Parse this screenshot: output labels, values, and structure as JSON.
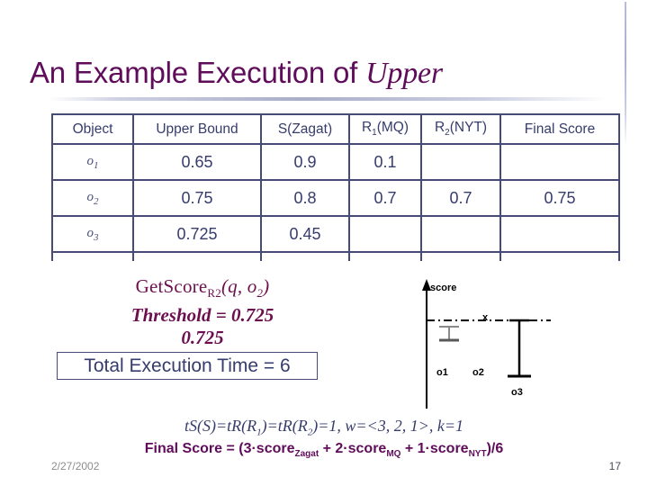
{
  "slide": {
    "title_plain": "An Example Execution of ",
    "title_emphasis": "Upper",
    "accent_color": "#5f0d5a",
    "table_color": "#363c6b",
    "highlight_color": "#7c0b3c"
  },
  "table": {
    "headers": [
      {
        "text": "Object",
        "sub": ""
      },
      {
        "text": "Upper Bound",
        "sub": ""
      },
      {
        "text": "S(Zagat)",
        "sub": ""
      },
      {
        "text": "R",
        "sub": "1",
        "tail": "(MQ)"
      },
      {
        "text": "R",
        "sub": "2",
        "tail": "(NYT)"
      },
      {
        "text": "Final Score",
        "sub": ""
      }
    ],
    "header_labels": [
      "Object",
      "Upper Bound",
      "S(Zagat)",
      "R1(MQ)",
      "R2(NYT)",
      "Final Score"
    ],
    "rows": [
      {
        "object": "o",
        "object_sub": "1",
        "upper_bound": "0.65",
        "upper_bound_highlight": false,
        "s_zagat": "0.9",
        "r1_mq": "0.1",
        "r2_nyt": "",
        "final_score": ""
      },
      {
        "object": "o",
        "object_sub": "2",
        "upper_bound": "0.75",
        "upper_bound_highlight": true,
        "s_zagat": "0.8",
        "r1_mq": "0.7",
        "r2_nyt": "0.7",
        "final_score": "0.75"
      },
      {
        "object": "o",
        "object_sub": "3",
        "upper_bound": "0.725",
        "upper_bound_highlight": false,
        "s_zagat": "0.45",
        "r1_mq": "",
        "r2_nyt": "",
        "final_score": ""
      }
    ]
  },
  "annotations": {
    "getscore_name": "GetScore",
    "getscore_sub": "R2",
    "getscore_args": "(q, o",
    "getscore_args_sub": "2",
    "getscore_args_end": ")",
    "threshold_line": "Threshold = 0.725",
    "threshold_value": "0.725",
    "total_time": "Total Execution Time = 6"
  },
  "diagram": {
    "axis_label": "score",
    "marker_label": "x",
    "o1_label": "o1",
    "o2_label": "o2",
    "o3_label": "o3"
  },
  "formulas": {
    "line1": "tS(S)=tR(R1)=tR(R2)=1, w=<3, 2, 1>, k=1",
    "line1_parts": {
      "a": "tS(S)=tR(R",
      "a_sub": "1",
      "b": ")=tR(R",
      "b_sub": "2",
      "c": ")=1, w=<3, 2, 1>, k=1"
    },
    "line2": "Final Score = (3·scoreZagat + 2·scoreMQ + 1·scoreNYT)/6",
    "line2_parts": {
      "a": "Final Score = (3·score",
      "a_sub": "Zagat",
      "b": " + 2·score",
      "b_sub": "MQ",
      "c": " + 1·score",
      "c_sub": "NYT",
      "d": ")/6"
    }
  },
  "footer": {
    "date": "2/27/2002",
    "page": "17"
  }
}
